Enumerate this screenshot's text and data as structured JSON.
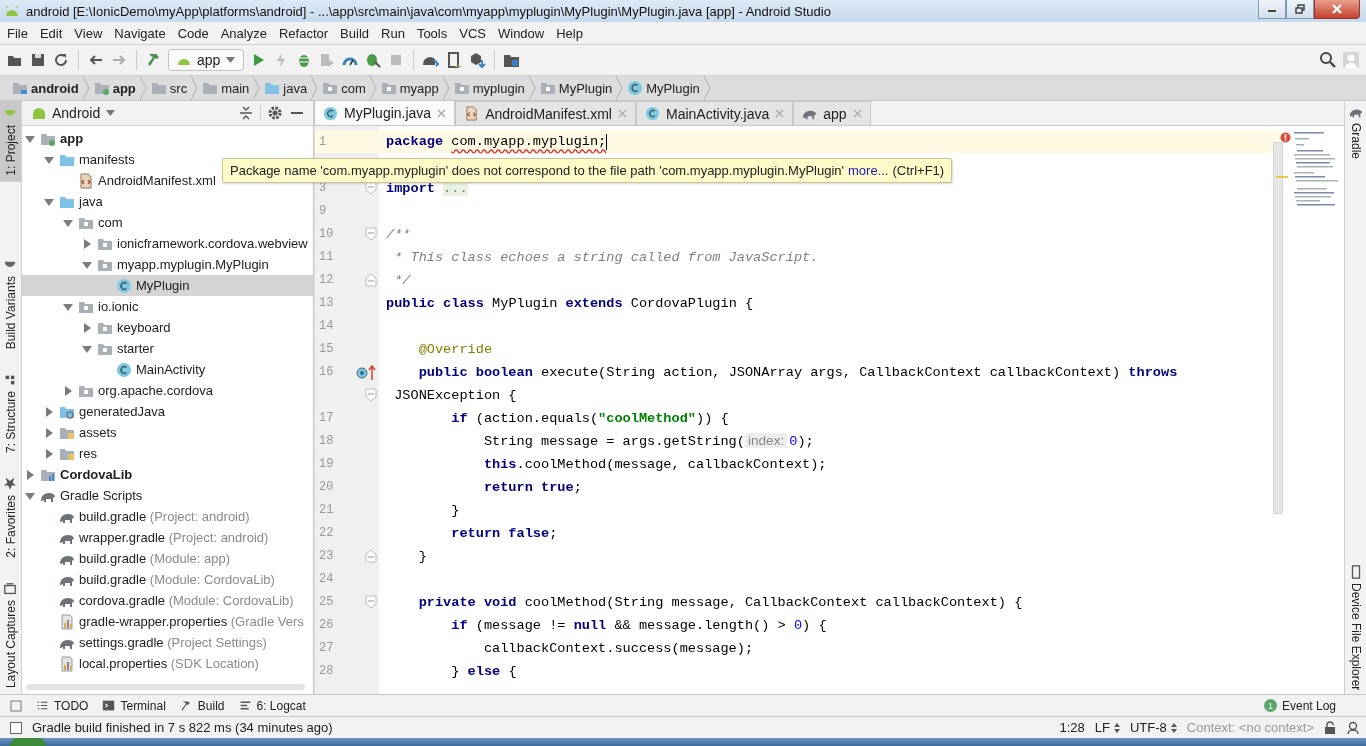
{
  "window": {
    "title": "android [E:\\IonicDemo\\myApp\\platforms\\android] - ...\\app\\src\\main\\java\\com\\myapp\\myplugin\\MyPlugin\\MyPlugin.java [app] - Android Studio"
  },
  "menu": [
    "File",
    "Edit",
    "View",
    "Navigate",
    "Code",
    "Analyze",
    "Refactor",
    "Build",
    "Run",
    "Tools",
    "VCS",
    "Window",
    "Help"
  ],
  "toolbar": {
    "run_config": "app"
  },
  "breadcrumbs": [
    {
      "label": "android",
      "bold": true,
      "kind": "project"
    },
    {
      "label": "app",
      "bold": true,
      "kind": "module"
    },
    {
      "label": "src",
      "bold": false,
      "kind": "folder"
    },
    {
      "label": "main",
      "bold": false,
      "kind": "folder"
    },
    {
      "label": "java",
      "bold": false,
      "kind": "source"
    },
    {
      "label": "com",
      "bold": false,
      "kind": "package"
    },
    {
      "label": "myapp",
      "bold": false,
      "kind": "package"
    },
    {
      "label": "myplugin",
      "bold": false,
      "kind": "package"
    },
    {
      "label": "MyPlugin",
      "bold": false,
      "kind": "package"
    },
    {
      "label": "MyPlugin",
      "bold": false,
      "kind": "class"
    }
  ],
  "left_stripe": [
    {
      "label": "1: Project",
      "selected": true
    },
    {
      "label": "Build Variants",
      "selected": false
    },
    {
      "label": "7: Structure",
      "selected": false
    },
    {
      "label": "2: Favorites",
      "selected": false
    },
    {
      "label": "Layout Captures",
      "selected": false
    }
  ],
  "project_panel": {
    "view": "Android",
    "tree": [
      {
        "label": "app",
        "bold": true,
        "kind": "module",
        "expanded": true,
        "selected": false,
        "children": [
          {
            "label": "manifests",
            "bold": false,
            "kind": "source",
            "expanded": true,
            "selected": false,
            "children": [
              {
                "label": "AndroidManifest.xml",
                "bold": false,
                "kind": "manifest",
                "selected": false
              }
            ]
          },
          {
            "label": "java",
            "bold": false,
            "kind": "source",
            "expanded": true,
            "selected": false,
            "children": [
              {
                "label": "com",
                "bold": false,
                "kind": "package",
                "expanded": true,
                "selected": false,
                "children": [
                  {
                    "label": "ionicframework.cordova.webview",
                    "bold": false,
                    "kind": "package",
                    "expanded": false,
                    "selected": false
                  },
                  {
                    "label": "myapp.myplugin.MyPlugin",
                    "bold": false,
                    "kind": "package",
                    "expanded": true,
                    "selected": false,
                    "children": [
                      {
                        "label": "MyPlugin",
                        "bold": false,
                        "kind": "class",
                        "selected": true
                      }
                    ]
                  }
                ]
              },
              {
                "label": "io.ionic",
                "bold": false,
                "kind": "package",
                "expanded": true,
                "selected": false,
                "children": [
                  {
                    "label": "keyboard",
                    "bold": false,
                    "kind": "package",
                    "expanded": false,
                    "selected": false
                  },
                  {
                    "label": "starter",
                    "bold": false,
                    "kind": "package",
                    "expanded": true,
                    "selected": false,
                    "children": [
                      {
                        "label": "MainActivity",
                        "bold": false,
                        "kind": "class",
                        "selected": false
                      }
                    ]
                  }
                ]
              },
              {
                "label": "org.apache.cordova",
                "bold": false,
                "kind": "package",
                "expanded": false,
                "selected": false
              }
            ]
          },
          {
            "label": "generatedJava",
            "bold": false,
            "kind": "generated",
            "expanded": false,
            "selected": false
          },
          {
            "label": "assets",
            "bold": false,
            "kind": "resources",
            "expanded": false,
            "selected": false
          },
          {
            "label": "res",
            "bold": false,
            "kind": "resources",
            "expanded": false,
            "selected": false
          }
        ]
      },
      {
        "label": "CordovaLib",
        "bold": true,
        "kind": "library",
        "expanded": false,
        "selected": false
      },
      {
        "label": "Gradle Scripts",
        "bold": false,
        "kind": "gradle",
        "expanded": true,
        "selected": false,
        "children": [
          {
            "label": "build.gradle",
            "detail": "(Project: android)",
            "bold": false,
            "kind": "gradle",
            "selected": false
          },
          {
            "label": "wrapper.gradle",
            "detail": "(Project: android)",
            "bold": false,
            "kind": "gradle",
            "selected": false
          },
          {
            "label": "build.gradle",
            "detail": "(Module: app)",
            "bold": false,
            "kind": "gradle",
            "selected": false
          },
          {
            "label": "build.gradle",
            "detail": "(Module: CordovaLib)",
            "bold": false,
            "kind": "gradle",
            "selected": false
          },
          {
            "label": "cordova.gradle",
            "detail": "(Module: CordovaLib)",
            "bold": false,
            "kind": "gradle",
            "selected": false
          },
          {
            "label": "gradle-wrapper.properties",
            "detail": "(Gradle Vers",
            "bold": false,
            "kind": "properties",
            "selected": false
          },
          {
            "label": "settings.gradle",
            "detail": "(Project Settings)",
            "bold": false,
            "kind": "gradle",
            "selected": false
          },
          {
            "label": "local.properties",
            "detail": "(SDK Location)",
            "bold": false,
            "kind": "properties",
            "selected": false
          }
        ]
      }
    ]
  },
  "editor_tabs": [
    {
      "label": "MyPlugin.java",
      "kind": "class",
      "selected": true
    },
    {
      "label": "AndroidManifest.xml",
      "kind": "manifest",
      "selected": false
    },
    {
      "label": "MainActivity.java",
      "kind": "class",
      "selected": false
    },
    {
      "label": "app",
      "kind": "gradle",
      "selected": false
    }
  ],
  "code": [
    {
      "number": "1",
      "current": true,
      "kind": "plain",
      "tokens": [
        {
          "kind": "kw",
          "text": "package "
        },
        {
          "kind": "err",
          "text": "com.myapp.myplugin;"
        }
      ]
    },
    {
      "current": false,
      "kind": "plain"
    },
    {
      "number": "3",
      "current": false,
      "kind": "foldstart",
      "tokens": [
        {
          "kind": "kw",
          "text": "import "
        },
        {
          "kind": "fold",
          "text": "..."
        }
      ]
    },
    {
      "number": "9",
      "current": false,
      "kind": "plain"
    },
    {
      "number": "10",
      "current": false,
      "kind": "foldstart",
      "tokens": [
        {
          "kind": "cmt",
          "text": "/**"
        }
      ]
    },
    {
      "number": "11",
      "current": false,
      "kind": "plain",
      "tokens": [
        {
          "kind": "cmt",
          "text": " * This class echoes a string called from JavaScript."
        }
      ]
    },
    {
      "number": "12",
      "current": false,
      "kind": "foldend",
      "tokens": [
        {
          "kind": "cmt",
          "text": " */"
        }
      ]
    },
    {
      "number": "13",
      "current": false,
      "kind": "plain",
      "tokens": [
        {
          "kind": "kw",
          "text": "public class"
        },
        {
          "kind": "plain",
          "text": " MyPlugin "
        },
        {
          "kind": "kw",
          "text": "extends"
        },
        {
          "kind": "plain",
          "text": " CordovaPlugin {"
        }
      ]
    },
    {
      "number": "14",
      "current": false,
      "kind": "plain"
    },
    {
      "number": "15",
      "current": false,
      "kind": "plain",
      "tokens": [
        {
          "kind": "ann",
          "text": "    @Override"
        }
      ]
    },
    {
      "number": "16",
      "current": false,
      "kind": "override",
      "tokens": [
        {
          "kind": "kw",
          "text": "    public boolean"
        },
        {
          "kind": "plain",
          "text": " execute(String action, JSONArray args, CallbackContext callbackContext) "
        },
        {
          "kind": "kw",
          "text": "throws"
        }
      ]
    },
    {
      "current": false,
      "kind": "foldstart",
      "tokens": [
        {
          "kind": "plain",
          "text": " JSONException {"
        }
      ]
    },
    {
      "number": "17",
      "current": false,
      "kind": "plain",
      "tokens": [
        {
          "kind": "kw",
          "text": "        if"
        },
        {
          "kind": "plain",
          "text": " (action.equals("
        },
        {
          "kind": "str",
          "text": "\"coolMethod\""
        },
        {
          "kind": "plain",
          "text": ")) {"
        }
      ]
    },
    {
      "number": "18",
      "current": false,
      "kind": "plain",
      "tokens": [
        {
          "kind": "plain",
          "text": "            String message = args.getString("
        },
        {
          "kind": "hint",
          "text": "index:"
        },
        {
          "kind": "num",
          "text": "0"
        },
        {
          "kind": "plain",
          "text": ");"
        }
      ]
    },
    {
      "number": "19",
      "current": false,
      "kind": "plain",
      "tokens": [
        {
          "kind": "kw",
          "text": "            this"
        },
        {
          "kind": "plain",
          "text": ".coolMethod(message, callbackContext);"
        }
      ]
    },
    {
      "number": "20",
      "current": false,
      "kind": "plain",
      "tokens": [
        {
          "kind": "kw",
          "text": "            return true"
        },
        {
          "kind": "plain",
          "text": ";"
        }
      ]
    },
    {
      "number": "21",
      "current": false,
      "kind": "plain",
      "tokens": [
        {
          "kind": "plain",
          "text": "        }"
        }
      ]
    },
    {
      "number": "22",
      "current": false,
      "kind": "plain",
      "tokens": [
        {
          "kind": "kw",
          "text": "        return false"
        },
        {
          "kind": "plain",
          "text": ";"
        }
      ]
    },
    {
      "number": "23",
      "current": false,
      "kind": "foldend",
      "tokens": [
        {
          "kind": "plain",
          "text": "    }"
        }
      ]
    },
    {
      "number": "24",
      "current": false,
      "kind": "plain"
    },
    {
      "number": "25",
      "current": false,
      "kind": "foldstart",
      "tokens": [
        {
          "kind": "kw",
          "text": "    private void"
        },
        {
          "kind": "plain",
          "text": " coolMethod(String message, CallbackContext callbackContext) {"
        }
      ]
    },
    {
      "number": "26",
      "current": false,
      "kind": "plain",
      "tokens": [
        {
          "kind": "kw",
          "text": "        if"
        },
        {
          "kind": "plain",
          "text": " (message != "
        },
        {
          "kind": "kw",
          "text": "null"
        },
        {
          "kind": "plain",
          "text": " && message.length() > "
        },
        {
          "kind": "num",
          "text": "0"
        },
        {
          "kind": "plain",
          "text": ") {"
        }
      ]
    },
    {
      "number": "27",
      "current": false,
      "kind": "plain",
      "tokens": [
        {
          "kind": "plain",
          "text": "            callbackContext.success(message);"
        }
      ]
    },
    {
      "number": "28",
      "current": false,
      "kind": "plain",
      "tokens": [
        {
          "kind": "plain",
          "text": "        } "
        },
        {
          "kind": "kw",
          "text": "else"
        },
        {
          "kind": "plain",
          "text": " {"
        }
      ]
    }
  ],
  "tooltip": {
    "text": "Package name 'com.myapp.myplugin' does not correspond to the file path 'com.myapp.myplugin.MyPlugin'",
    "link": "more...",
    "shortcut": "(Ctrl+F1)"
  },
  "right_stripe": [
    {
      "label": "Gradle"
    },
    {
      "label": "Device File Explorer"
    }
  ],
  "bottom_tools": [
    {
      "label": "TODO",
      "kind": "list"
    },
    {
      "label": "Terminal",
      "kind": "terminal"
    },
    {
      "label": "Build",
      "kind": "hammer"
    },
    {
      "label": "6: Logcat",
      "kind": "logcat"
    }
  ],
  "event_log": {
    "count": "1",
    "label": "Event Log"
  },
  "status": {
    "message": "Gradle build finished in 7 s 822 ms (34 minutes ago)",
    "position": "1:28",
    "line_separator": "LF",
    "encoding": "UTF-8",
    "context": "Context: <no context>"
  }
}
